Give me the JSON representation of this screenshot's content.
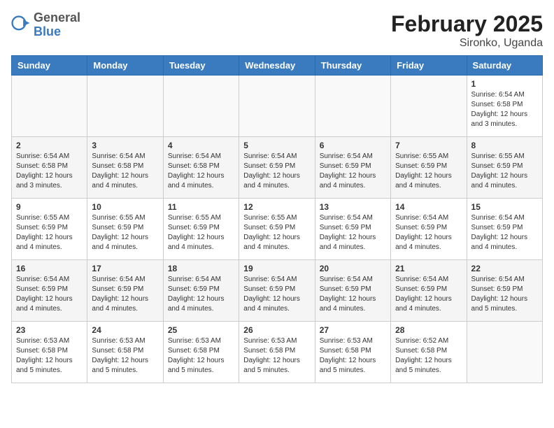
{
  "app": {
    "logo_general": "General",
    "logo_blue": "Blue"
  },
  "title": "February 2025",
  "subtitle": "Sironko, Uganda",
  "weekdays": [
    "Sunday",
    "Monday",
    "Tuesday",
    "Wednesday",
    "Thursday",
    "Friday",
    "Saturday"
  ],
  "weeks": [
    [
      {
        "day": "",
        "info": ""
      },
      {
        "day": "",
        "info": ""
      },
      {
        "day": "",
        "info": ""
      },
      {
        "day": "",
        "info": ""
      },
      {
        "day": "",
        "info": ""
      },
      {
        "day": "",
        "info": ""
      },
      {
        "day": "1",
        "info": "Sunrise: 6:54 AM\nSunset: 6:58 PM\nDaylight: 12 hours and 3 minutes."
      }
    ],
    [
      {
        "day": "2",
        "info": "Sunrise: 6:54 AM\nSunset: 6:58 PM\nDaylight: 12 hours and 3 minutes."
      },
      {
        "day": "3",
        "info": "Sunrise: 6:54 AM\nSunset: 6:58 PM\nDaylight: 12 hours and 4 minutes."
      },
      {
        "day": "4",
        "info": "Sunrise: 6:54 AM\nSunset: 6:58 PM\nDaylight: 12 hours and 4 minutes."
      },
      {
        "day": "5",
        "info": "Sunrise: 6:54 AM\nSunset: 6:59 PM\nDaylight: 12 hours and 4 minutes."
      },
      {
        "day": "6",
        "info": "Sunrise: 6:54 AM\nSunset: 6:59 PM\nDaylight: 12 hours and 4 minutes."
      },
      {
        "day": "7",
        "info": "Sunrise: 6:55 AM\nSunset: 6:59 PM\nDaylight: 12 hours and 4 minutes."
      },
      {
        "day": "8",
        "info": "Sunrise: 6:55 AM\nSunset: 6:59 PM\nDaylight: 12 hours and 4 minutes."
      }
    ],
    [
      {
        "day": "9",
        "info": "Sunrise: 6:55 AM\nSunset: 6:59 PM\nDaylight: 12 hours and 4 minutes."
      },
      {
        "day": "10",
        "info": "Sunrise: 6:55 AM\nSunset: 6:59 PM\nDaylight: 12 hours and 4 minutes."
      },
      {
        "day": "11",
        "info": "Sunrise: 6:55 AM\nSunset: 6:59 PM\nDaylight: 12 hours and 4 minutes."
      },
      {
        "day": "12",
        "info": "Sunrise: 6:55 AM\nSunset: 6:59 PM\nDaylight: 12 hours and 4 minutes."
      },
      {
        "day": "13",
        "info": "Sunrise: 6:54 AM\nSunset: 6:59 PM\nDaylight: 12 hours and 4 minutes."
      },
      {
        "day": "14",
        "info": "Sunrise: 6:54 AM\nSunset: 6:59 PM\nDaylight: 12 hours and 4 minutes."
      },
      {
        "day": "15",
        "info": "Sunrise: 6:54 AM\nSunset: 6:59 PM\nDaylight: 12 hours and 4 minutes."
      }
    ],
    [
      {
        "day": "16",
        "info": "Sunrise: 6:54 AM\nSunset: 6:59 PM\nDaylight: 12 hours and 4 minutes."
      },
      {
        "day": "17",
        "info": "Sunrise: 6:54 AM\nSunset: 6:59 PM\nDaylight: 12 hours and 4 minutes."
      },
      {
        "day": "18",
        "info": "Sunrise: 6:54 AM\nSunset: 6:59 PM\nDaylight: 12 hours and 4 minutes."
      },
      {
        "day": "19",
        "info": "Sunrise: 6:54 AM\nSunset: 6:59 PM\nDaylight: 12 hours and 4 minutes."
      },
      {
        "day": "20",
        "info": "Sunrise: 6:54 AM\nSunset: 6:59 PM\nDaylight: 12 hours and 4 minutes."
      },
      {
        "day": "21",
        "info": "Sunrise: 6:54 AM\nSunset: 6:59 PM\nDaylight: 12 hours and 4 minutes."
      },
      {
        "day": "22",
        "info": "Sunrise: 6:54 AM\nSunset: 6:59 PM\nDaylight: 12 hours and 5 minutes."
      }
    ],
    [
      {
        "day": "23",
        "info": "Sunrise: 6:53 AM\nSunset: 6:58 PM\nDaylight: 12 hours and 5 minutes."
      },
      {
        "day": "24",
        "info": "Sunrise: 6:53 AM\nSunset: 6:58 PM\nDaylight: 12 hours and 5 minutes."
      },
      {
        "day": "25",
        "info": "Sunrise: 6:53 AM\nSunset: 6:58 PM\nDaylight: 12 hours and 5 minutes."
      },
      {
        "day": "26",
        "info": "Sunrise: 6:53 AM\nSunset: 6:58 PM\nDaylight: 12 hours and 5 minutes."
      },
      {
        "day": "27",
        "info": "Sunrise: 6:53 AM\nSunset: 6:58 PM\nDaylight: 12 hours and 5 minutes."
      },
      {
        "day": "28",
        "info": "Sunrise: 6:52 AM\nSunset: 6:58 PM\nDaylight: 12 hours and 5 minutes."
      },
      {
        "day": "",
        "info": ""
      }
    ]
  ]
}
